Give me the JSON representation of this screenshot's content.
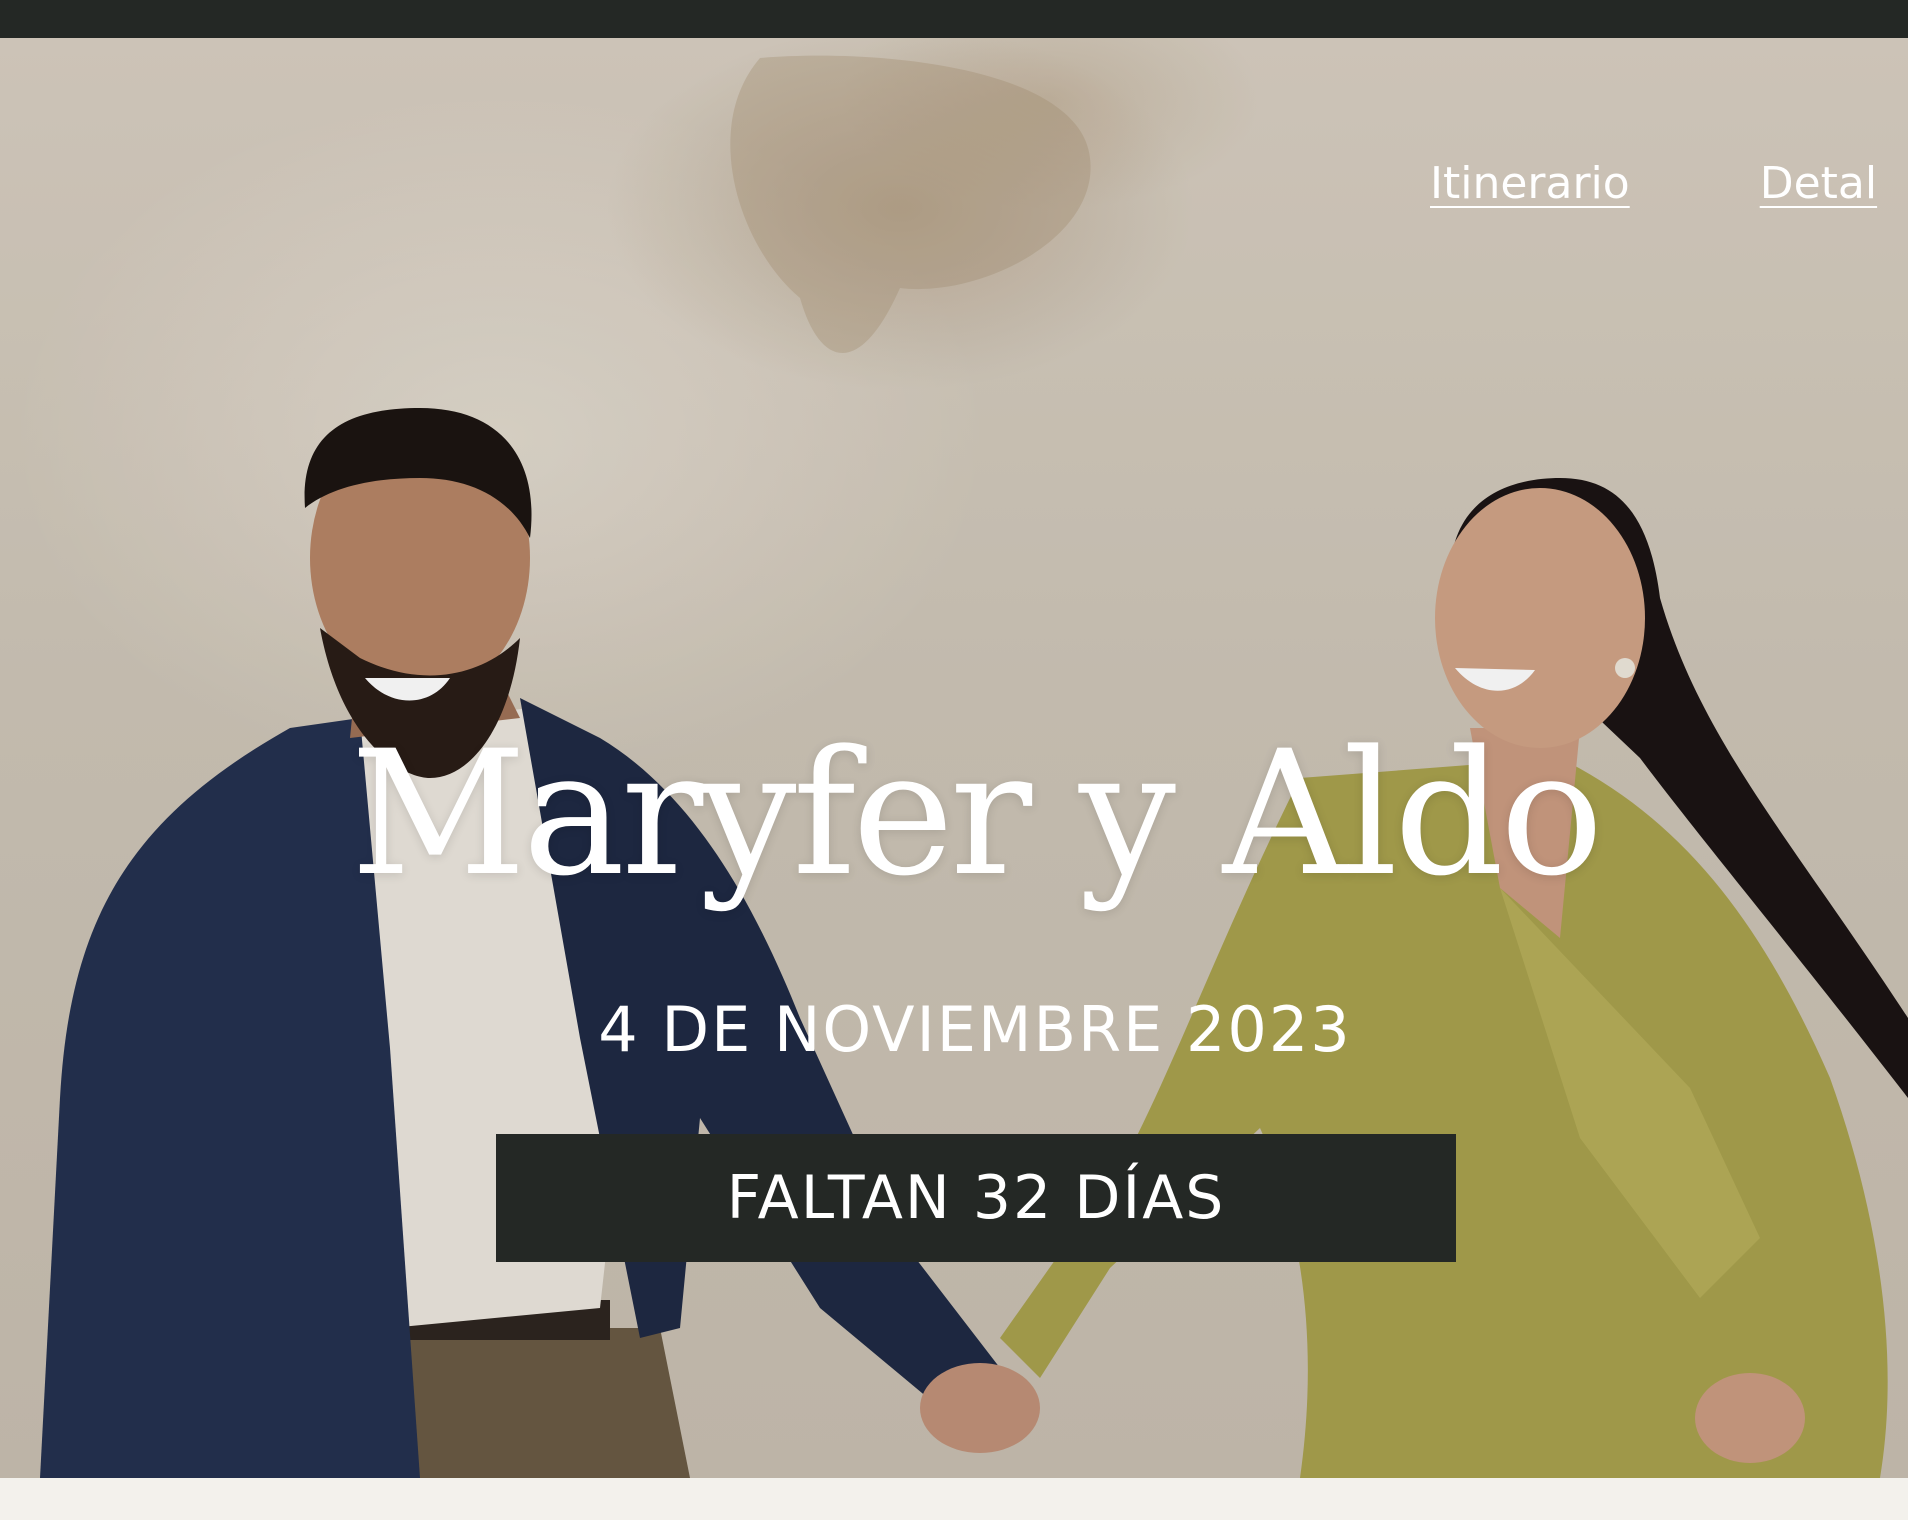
{
  "nav": {
    "items": [
      {
        "label": "Itinerario"
      },
      {
        "label": "Detal"
      }
    ]
  },
  "hero": {
    "title": "Maryfer y Aldo",
    "date": "4 DE NOVIEMBRE 2023",
    "countdown": "FALTAN 32 DÍAS"
  },
  "colors": {
    "top_bar": "#242825",
    "countdown_bg": "#242825",
    "text": "#ffffff",
    "page_bg": "#f3f1ec",
    "suit": "#253150",
    "dress": "#a9a24e"
  }
}
